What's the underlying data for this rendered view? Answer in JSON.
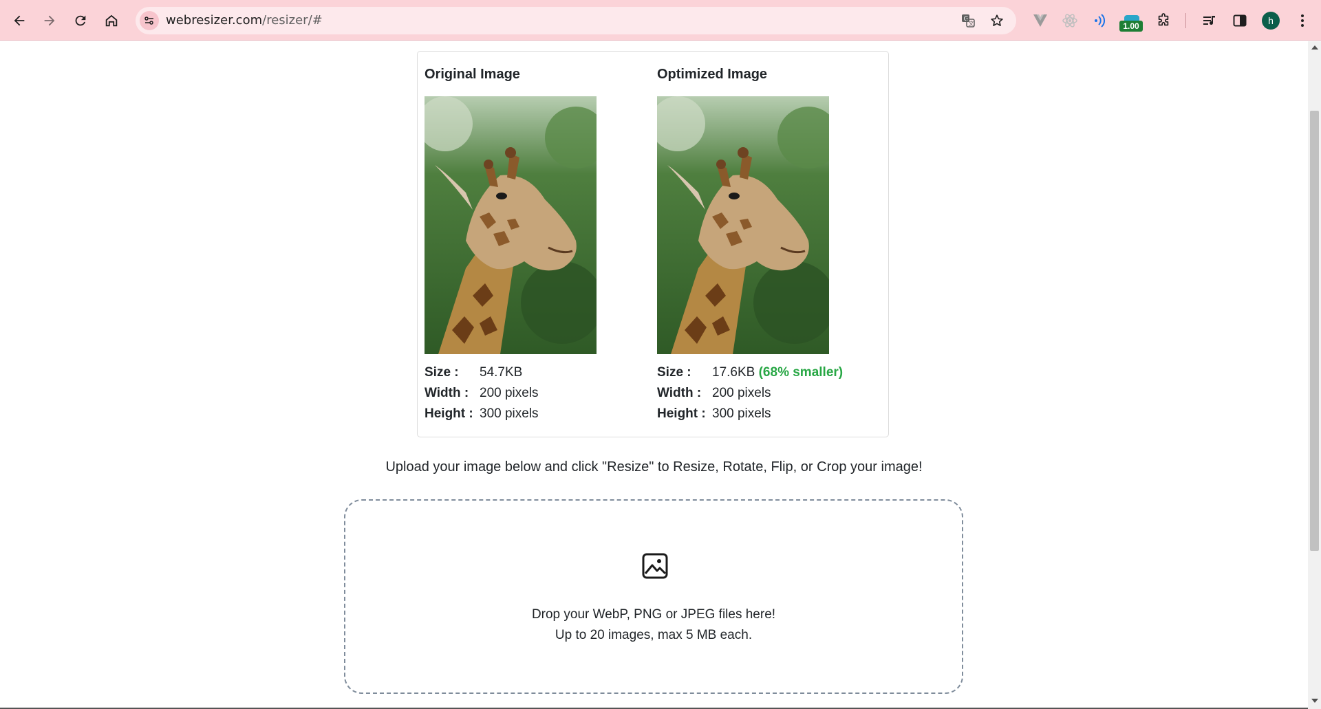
{
  "browser": {
    "url_domain": "webresizer.com",
    "url_path": "/resizer/#",
    "extension_badge": "1.00",
    "profile_initial": "h"
  },
  "comparison": {
    "original": {
      "title": "Original Image",
      "size_label": "Size :",
      "size_value": "54.7KB",
      "width_label": "Width :",
      "width_value": "200 pixels",
      "height_label": "Height :",
      "height_value": "300 pixels"
    },
    "optimized": {
      "title": "Optimized Image",
      "size_label": "Size :",
      "size_value": "17.6KB",
      "savings": "(68% smaller)",
      "width_label": "Width :",
      "width_value": "200 pixels",
      "height_label": "Height :",
      "height_value": "300 pixels"
    }
  },
  "instructions": "Upload your image below and click \"Resize\" to Resize, Rotate, Flip, or Crop your image!",
  "dropzone": {
    "line1": "Drop your WebP, PNG or JPEG files here!",
    "line2": "Up to 20 images, max 5 MB each."
  },
  "colors": {
    "toolbar": "#fbd3d8",
    "savings_green": "#28a745"
  }
}
